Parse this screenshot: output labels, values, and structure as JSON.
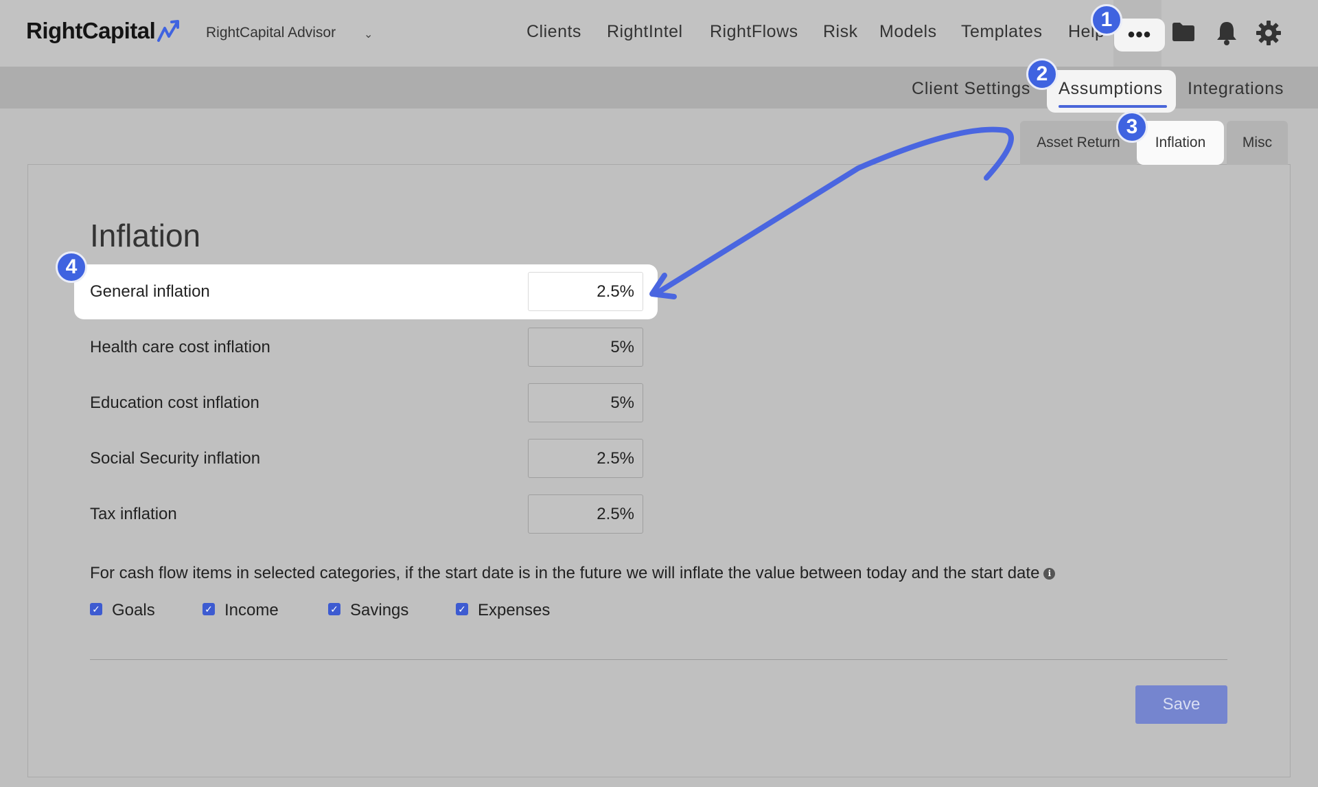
{
  "header": {
    "logo": "RightCapital",
    "advisor": "RightCapital Advisor",
    "nav": [
      "Clients",
      "RightIntel",
      "RightFlows",
      "Risk",
      "Models",
      "Templates",
      "Help"
    ],
    "more": "•••"
  },
  "subnav": {
    "items": [
      "Client Settings",
      "Assumptions",
      "Integrations"
    ],
    "active": "Assumptions"
  },
  "tabs": {
    "items": [
      "Asset Return",
      "Inflation",
      "Misc"
    ],
    "active": "Inflation"
  },
  "inflation": {
    "title": "Inflation",
    "rows": [
      {
        "label": "General inflation",
        "value": "2.5%"
      },
      {
        "label": "Health care cost inflation",
        "value": "5%"
      },
      {
        "label": "Education cost inflation",
        "value": "5%"
      },
      {
        "label": "Social Security inflation",
        "value": "2.5%"
      },
      {
        "label": "Tax inflation",
        "value": "2.5%"
      }
    ],
    "description": "For cash flow items in selected categories, if the start date is in the future we will inflate the value between today and the start date",
    "info": "i",
    "categories": [
      {
        "label": "Goals",
        "checked": true
      },
      {
        "label": "Income",
        "checked": true
      },
      {
        "label": "Savings",
        "checked": true
      },
      {
        "label": "Expenses",
        "checked": true
      }
    ],
    "save_label": "Save"
  },
  "steps": [
    "1",
    "2",
    "3",
    "4"
  ],
  "colors": {
    "accent": "#3f63e0",
    "save_button": "#7585cf",
    "arrow": "#4a66e0"
  }
}
